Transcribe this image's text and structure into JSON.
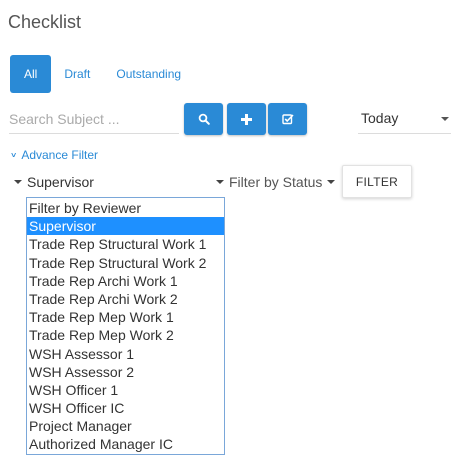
{
  "page": {
    "title": "Checklist"
  },
  "tabs": [
    {
      "label": "All"
    },
    {
      "label": "Draft"
    },
    {
      "label": "Outstanding"
    }
  ],
  "search": {
    "placeholder": "Search Subject ..."
  },
  "toolbar": {
    "buttons": [
      {
        "icon": "search-icon"
      },
      {
        "icon": "plus-icon"
      },
      {
        "icon": "checkbox-icon"
      }
    ],
    "accent_color": "#2a8ad6"
  },
  "date_filter": {
    "value": "Today"
  },
  "advance_filter": {
    "label": "Advance Filter"
  },
  "reviewer_select": {
    "value": "Supervisor"
  },
  "status_select": {
    "value": "Filter by Status"
  },
  "filter_button": {
    "label": "FILTER"
  },
  "reviewer_options": [
    "Filter by Reviewer",
    "Supervisor",
    "Trade Rep Structural Work 1",
    "Trade Rep Structural Work 2",
    "Trade Rep Archi Work 1",
    "Trade Rep Archi Work 2",
    "Trade Rep Mep Work 1",
    "Trade Rep Mep Work 2",
    "WSH Assessor 1",
    "WSH Assessor 2",
    "WSH Officer 1",
    "WSH Officer IC",
    "Project Manager",
    "Authorized Manager IC"
  ],
  "selected_option": "Supervisor"
}
